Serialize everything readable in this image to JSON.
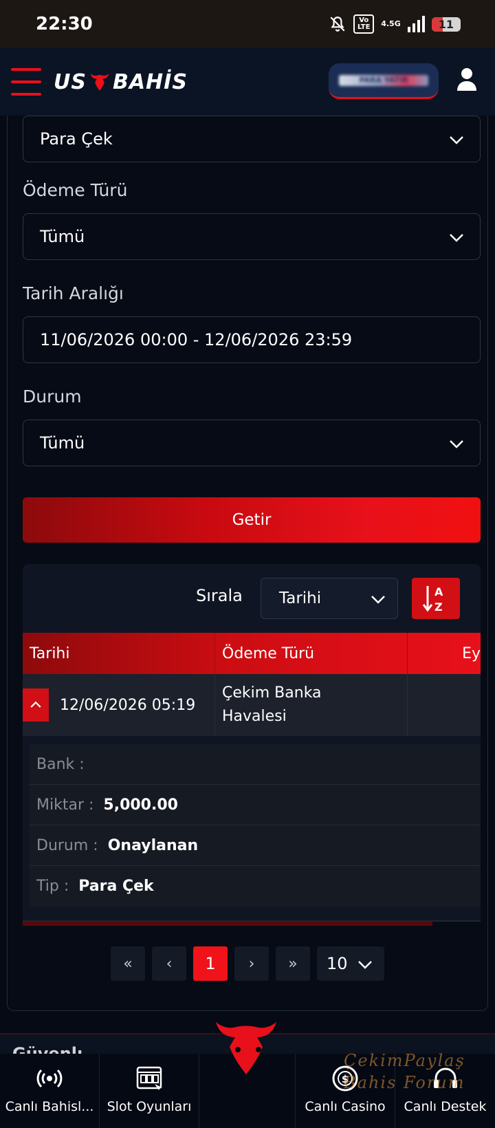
{
  "status_bar": {
    "time": "22:30",
    "volte": "Vo LTE",
    "network": "4.5G",
    "battery": "11"
  },
  "header": {
    "logo_left": "US",
    "logo_right": "BAHİS",
    "balance_text": "PARA YATIR"
  },
  "form": {
    "transaction_type": "Para Çek",
    "payment_type_label": "Ödeme Türü",
    "payment_type_value": "Tümü",
    "date_range_label": "Tarih Aralığı",
    "date_range_value": "11/06/2026 00:00 - 12/06/2026 23:59",
    "status_label": "Durum",
    "status_value": "Tümü",
    "submit_label": "Getir"
  },
  "results": {
    "sort_label": "Sırala",
    "sort_value": "Tarihi",
    "sort_icon_text_top": "A",
    "sort_icon_text_bottom": "Z",
    "columns": [
      "Tarihi",
      "Ödeme Türü",
      "Ey"
    ],
    "row": {
      "date": "12/06/2026 05:19",
      "payment_type": "Çekim Banka Havalesi"
    },
    "details": [
      {
        "label": "Bank :",
        "value": ""
      },
      {
        "label": "Miktar :",
        "value": "5,000.00"
      },
      {
        "label": "Durum :",
        "value": "Onaylanan"
      },
      {
        "label": "Tip :",
        "value": "Para Çek"
      }
    ]
  },
  "pagination": {
    "first": "«",
    "prev": "‹",
    "current": "1",
    "next": "›",
    "last": "»",
    "page_size": "10"
  },
  "footer": {
    "text": "Güvenlı"
  },
  "bottom_nav": {
    "items": [
      {
        "label": "Canlı Bahisl...",
        "icon": "live-broadcast-icon"
      },
      {
        "label": "Slot Oyunları",
        "icon": "slot-machine-icon"
      },
      {
        "label": "Canlı Casino",
        "icon": "casino-chip-icon"
      },
      {
        "label": "Canlı Destek",
        "icon": "headset-icon"
      }
    ]
  },
  "watermark": {
    "line1": "ÇekimPaylaş",
    "line2": "Bahis Forum"
  },
  "colors": {
    "accent": "#e8101a",
    "background": "#060a14",
    "header_bg": "#0b1424"
  }
}
